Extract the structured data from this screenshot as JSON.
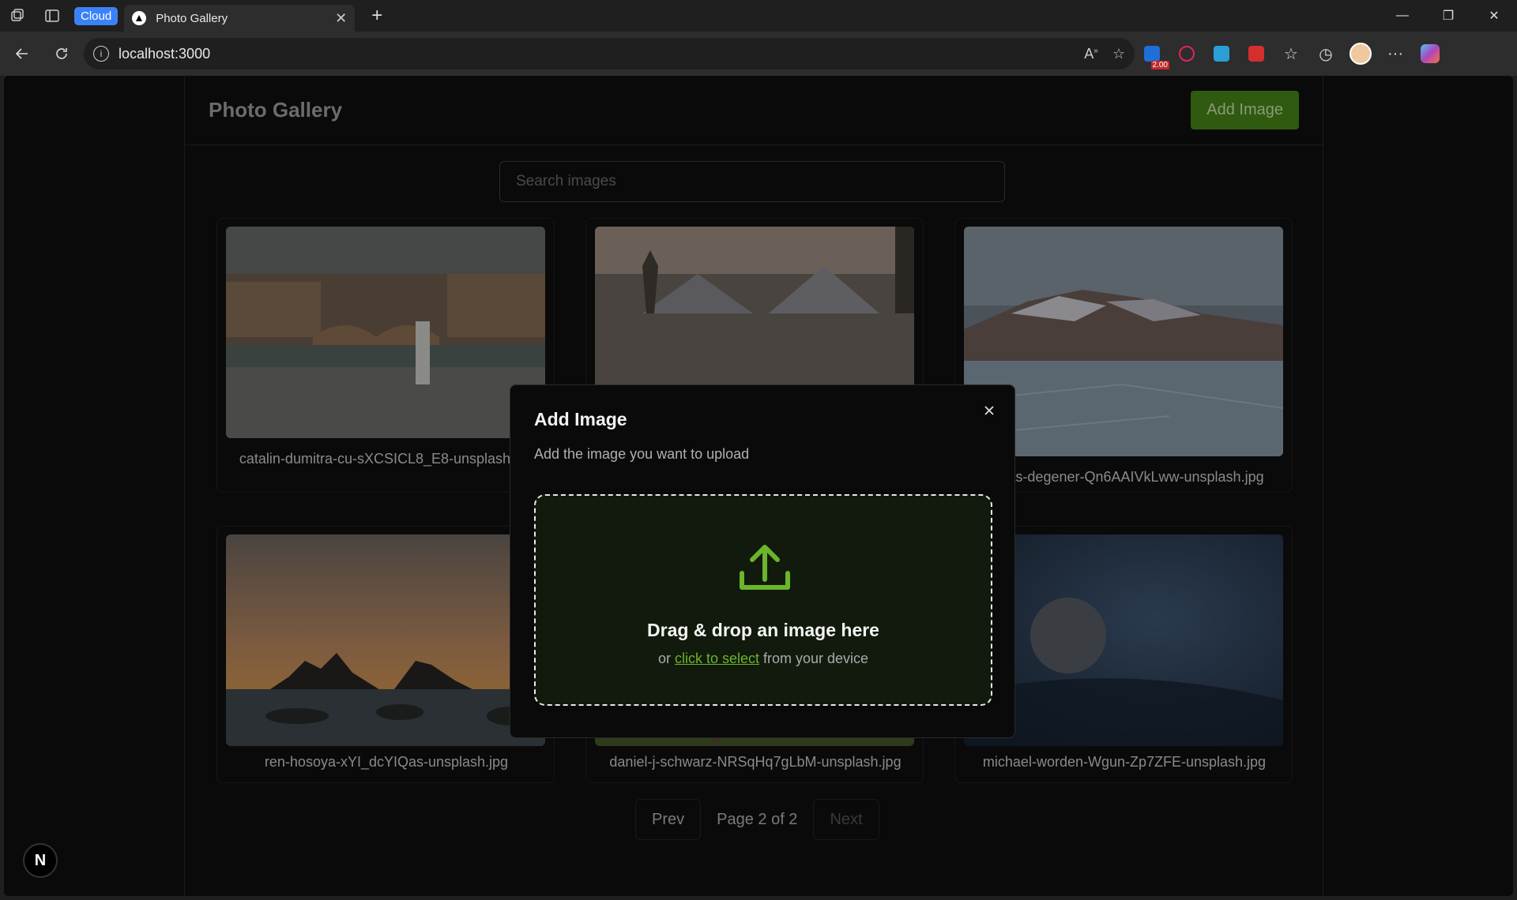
{
  "browser": {
    "cloud_badge": "Cloud",
    "tab_title": "Photo Gallery",
    "url": "localhost:3000",
    "extension_badge": "2.00"
  },
  "page": {
    "title": "Photo Gallery",
    "add_button": "Add Image",
    "search_placeholder": "Search images"
  },
  "gallery": {
    "items": [
      {
        "caption": "catalin-dumitra-cu-sXCSICL8_E8-unsplash.jpg"
      },
      {
        "caption": ""
      },
      {
        "caption": "tobias-degener-Qn6AAIVkLww-unsplash.jpg"
      },
      {
        "caption": "ren-hosoya-xYI_dcYIQas-unsplash.jpg"
      },
      {
        "caption": "daniel-j-schwarz-NRSqHq7gLbM-unsplash.jpg"
      },
      {
        "caption": "michael-worden-Wgun-Zp7ZFE-unsplash.jpg"
      }
    ]
  },
  "pagination": {
    "prev": "Prev",
    "label": "Page 2 of 2",
    "next": "Next"
  },
  "framework_badge": "N",
  "modal": {
    "title": "Add Image",
    "subtitle": "Add the image you want to upload",
    "drop_title": "Drag & drop an image here",
    "drop_prefix": "or ",
    "drop_link": "click to select",
    "drop_suffix": " from your device"
  },
  "colors": {
    "accent": "#6bb52b",
    "add_button_bg": "#2f5a0f"
  }
}
